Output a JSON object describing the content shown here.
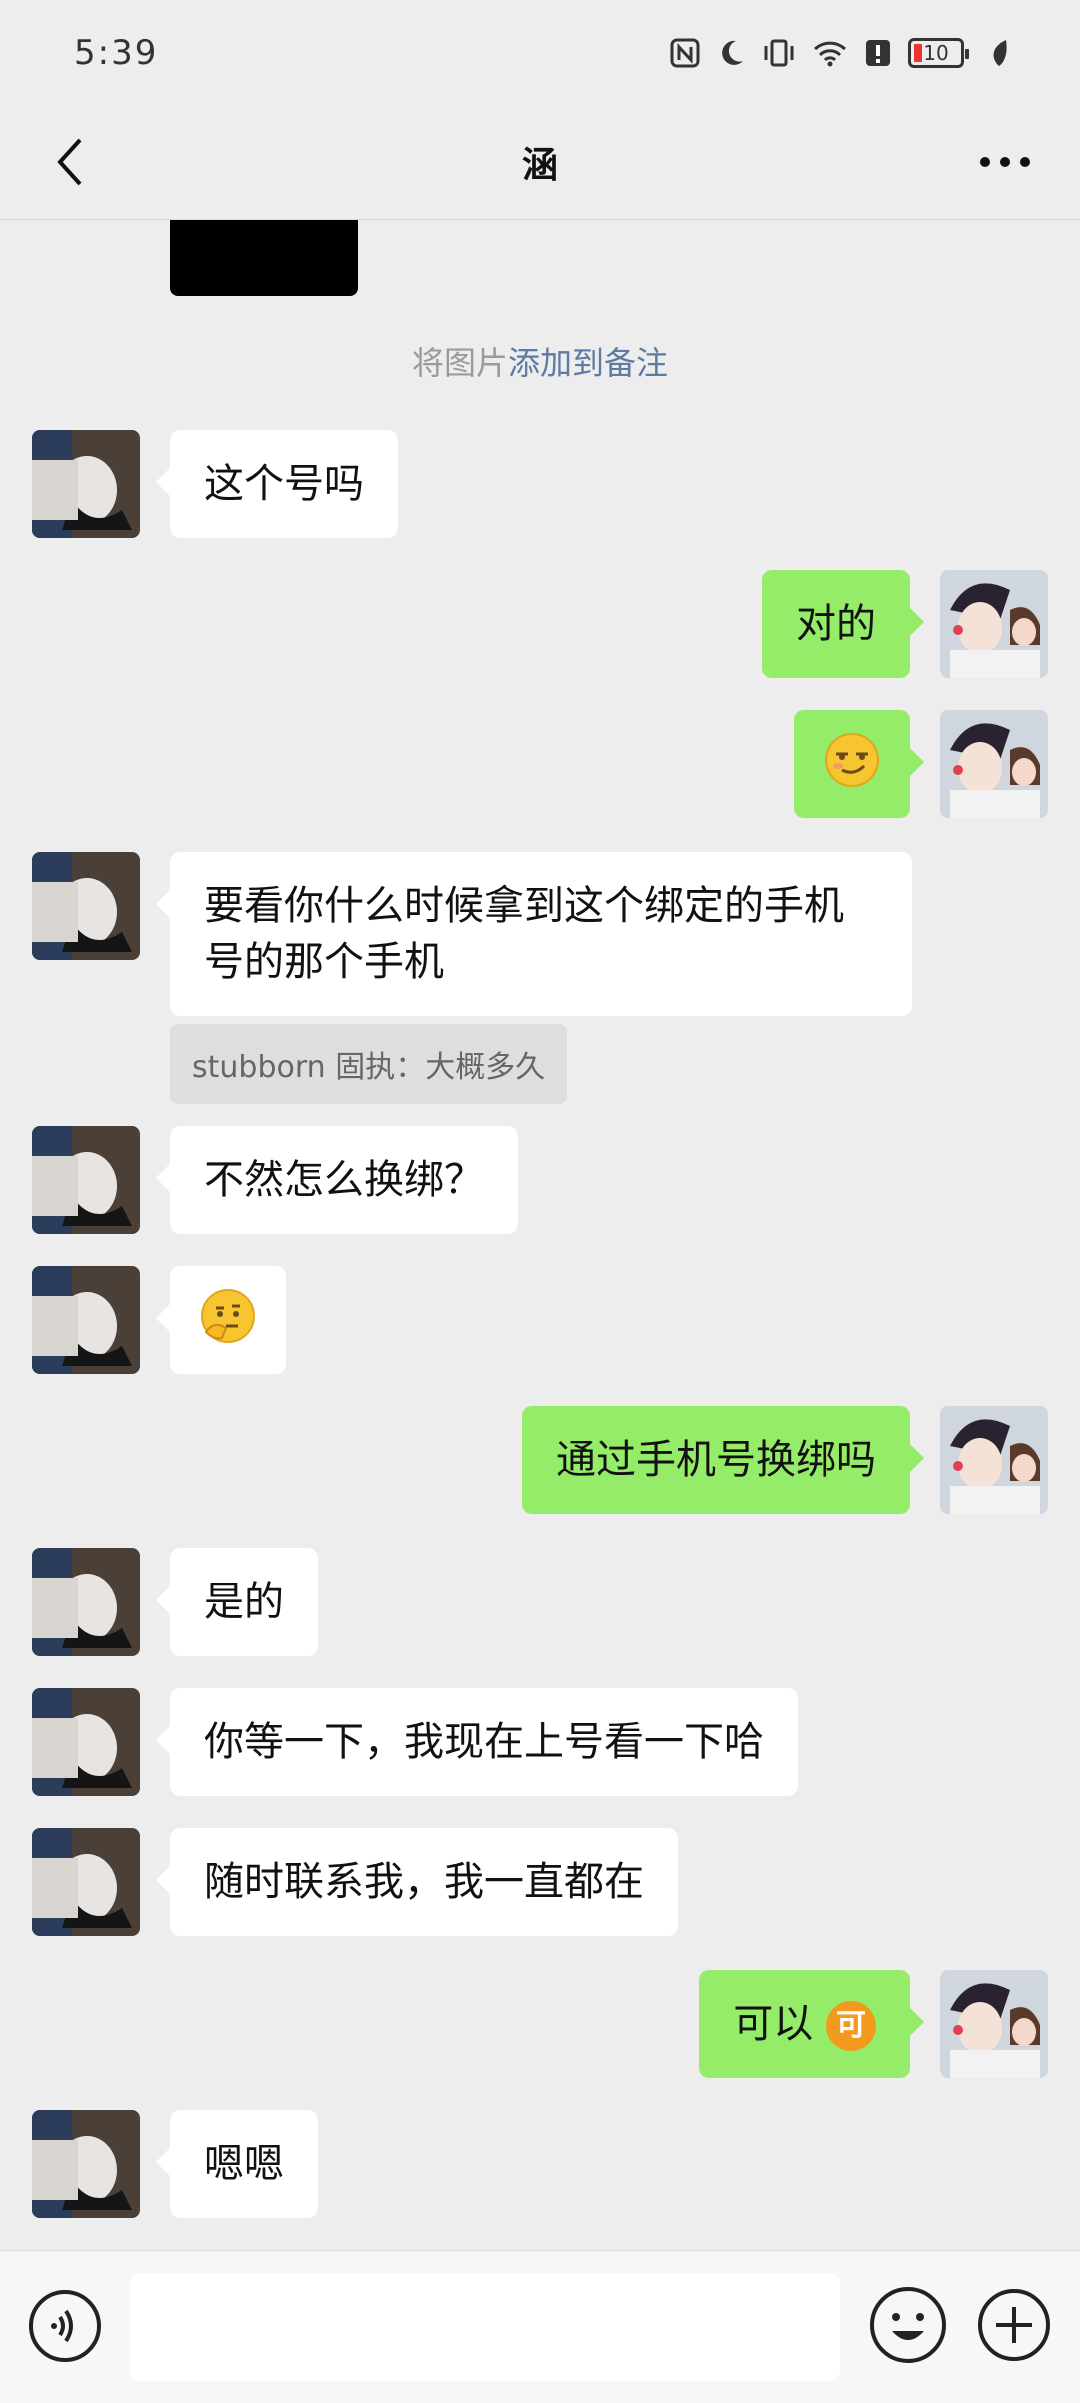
{
  "status": {
    "time": "5:39",
    "battery": "10"
  },
  "nav": {
    "title": "涵"
  },
  "system": {
    "prefix": "将图片",
    "link": "添加到备注"
  },
  "messages": [
    {
      "side": "in",
      "text": "这个号吗"
    },
    {
      "side": "out",
      "text": "对的"
    },
    {
      "side": "out",
      "emoji": "smirk-emoji"
    },
    {
      "side": "in",
      "text": "要看你什么时候拿到这个绑定的手机号的那个手机"
    },
    {
      "quote": "stubborn 固执：大概多久"
    },
    {
      "side": "in",
      "text": "不然怎么换绑？"
    },
    {
      "side": "in",
      "emoji": "thinking-emoji"
    },
    {
      "side": "out",
      "text": "通过手机号换绑吗"
    },
    {
      "side": "in",
      "text": "是的"
    },
    {
      "side": "in",
      "text": "你等一下，我现在上号看一下哈"
    },
    {
      "side": "in",
      "text": "随时联系我，我一直都在"
    },
    {
      "side": "out",
      "text": "可以",
      "badge": "可"
    },
    {
      "side": "in",
      "text": "嗯嗯"
    }
  ],
  "colors": {
    "outgoing_bubble": "#95ec69",
    "incoming_bubble": "#ffffff",
    "background": "#ededed",
    "link": "#5d7ba3"
  },
  "input": {
    "placeholder": ""
  }
}
